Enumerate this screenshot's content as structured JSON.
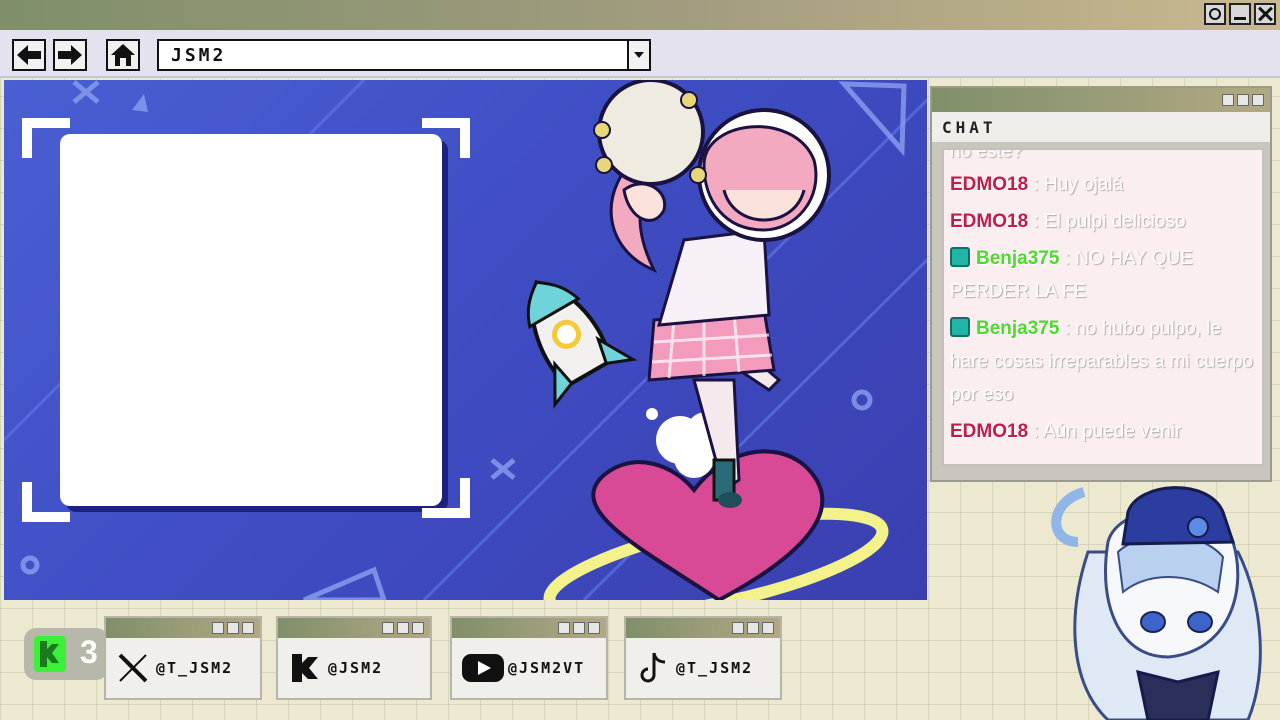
{
  "window": {
    "controls": [
      "record-icon",
      "minimize-icon",
      "close-icon"
    ]
  },
  "toolbar": {
    "back_icon": "arrow-left-icon",
    "forward_icon": "arrow-right-icon",
    "home_icon": "home-icon",
    "address": "JSM2"
  },
  "chat": {
    "title": "CHAT",
    "messages": [
      {
        "user": "",
        "text": "no este?"
      },
      {
        "user": "EDMO18",
        "separator": " : ",
        "text": "Huy ojalá",
        "color": "red",
        "badge": false
      },
      {
        "user": "EDMO18",
        "separator": " : ",
        "text": "El pulpi delicioso",
        "color": "red",
        "badge": false
      },
      {
        "user": "Benja375",
        "separator": " : ",
        "text": "NO HAY QUE PERDER LA FE",
        "color": "green",
        "badge": true
      },
      {
        "user": "Benja375",
        "separator": " : ",
        "text": "no hubo pulpo, le hare cosas irreparables a mi cuerpo por eso",
        "color": "green",
        "badge": true
      },
      {
        "user": "EDMO18",
        "separator": " : ",
        "text": "Aún puede venir",
        "color": "red",
        "badge": false
      }
    ]
  },
  "kick_badge": {
    "icon": "kick-icon",
    "count": "3"
  },
  "socials": [
    {
      "icon": "x-icon",
      "handle": "@T_JSM2"
    },
    {
      "icon": "kick-icon",
      "handle": "@JSM2"
    },
    {
      "icon": "youtube-icon",
      "handle": "@JSM2VT"
    },
    {
      "icon": "tiktok-icon",
      "handle": "@T_JSM2"
    }
  ],
  "colors": {
    "scene_blue": "#4150c8",
    "username_red": "#c01e4a",
    "username_green": "#4ed832",
    "kick_green": "#3cf03a"
  }
}
